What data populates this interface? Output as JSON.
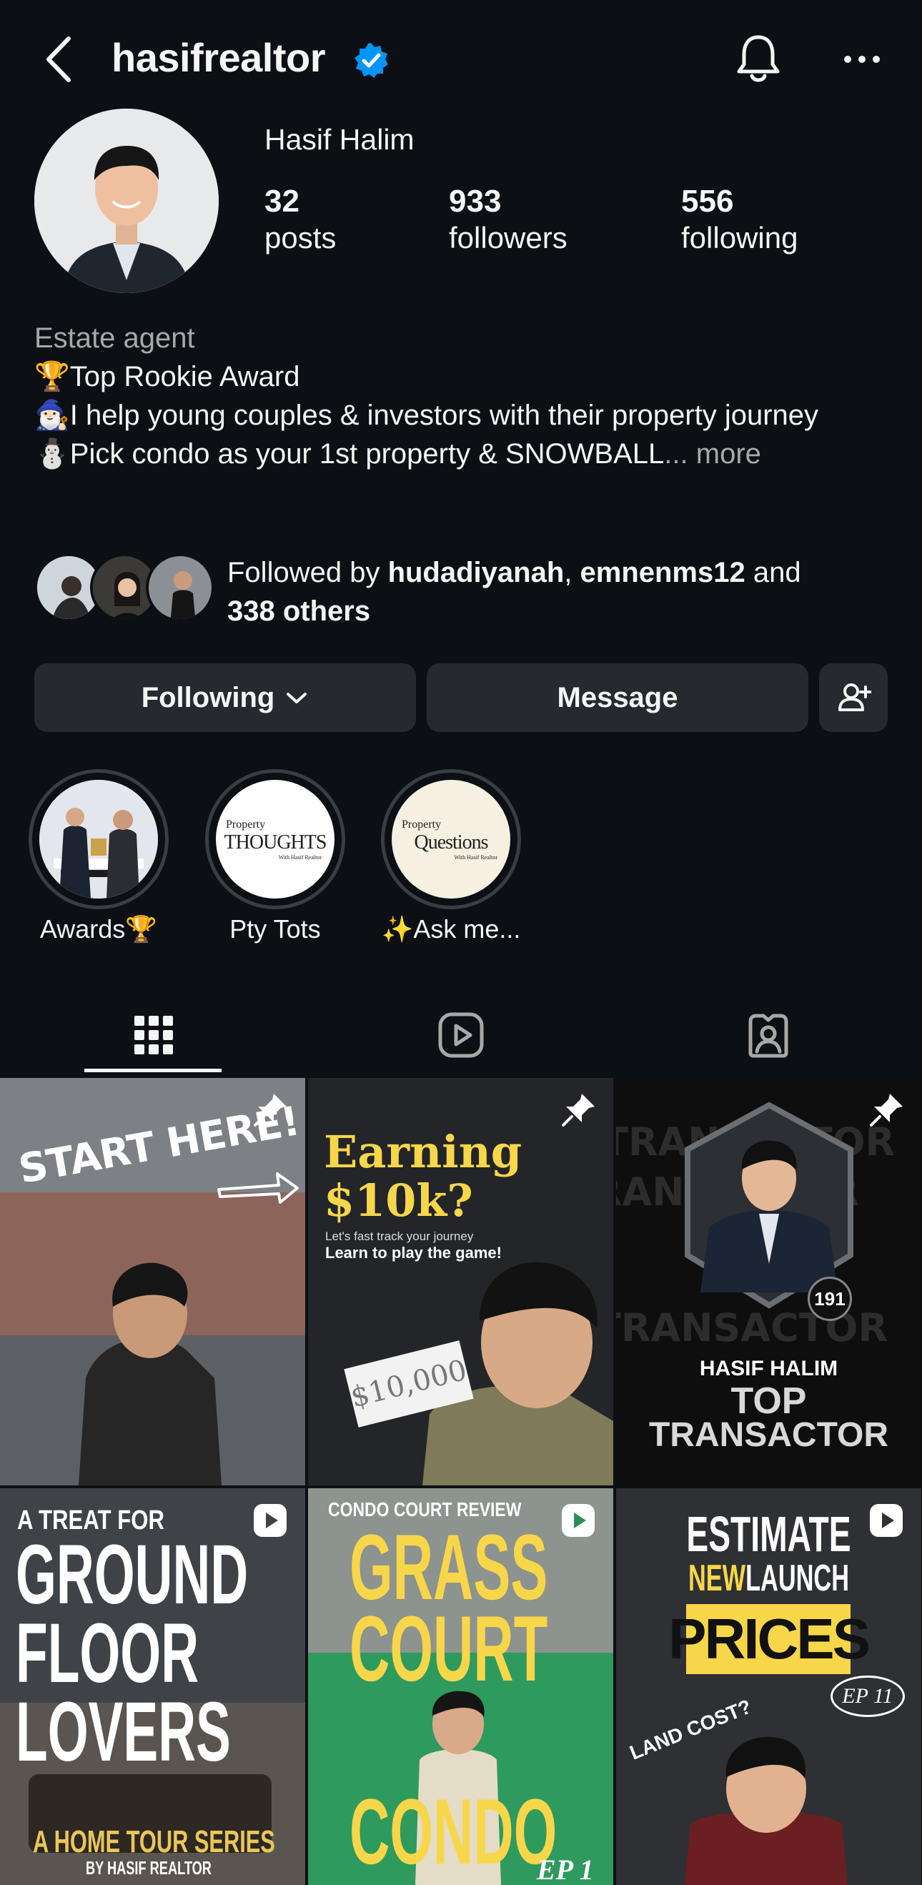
{
  "header": {
    "username": "hasifrealtor",
    "icons": [
      "back-arrow-icon",
      "verified-badge-icon",
      "bell-icon",
      "more-dots-icon"
    ]
  },
  "profile": {
    "display_name": "Hasif Halim",
    "stats": [
      {
        "value": "32",
        "label": "posts"
      },
      {
        "value": "933",
        "label": "followers"
      },
      {
        "value": "556",
        "label": "following"
      }
    ]
  },
  "bio": {
    "category": "Estate agent",
    "lines": [
      "🏆Top Rookie Award",
      "🧙🏻‍♂️I help young couples & investors with their property journey",
      "⛄Pick condo as your 1st property & SNOWBALL"
    ],
    "ellipsis": "...",
    "more": "more"
  },
  "followed_by": {
    "prefix": "Followed by ",
    "user1": "hudadiyanah",
    "sep": ", ",
    "user2": "emnenms12",
    "and": " and",
    "others": "338 others"
  },
  "actions": {
    "following": "Following",
    "message": "Message"
  },
  "highlights": [
    {
      "label": "Awards🏆",
      "cover_line1": "",
      "cover_line2": ""
    },
    {
      "label": "Pty Tots",
      "cover_line1": "Property",
      "cover_line2": "THOUGHTS",
      "cover_sub": "With Hasif Realtor"
    },
    {
      "label": "✨Ask me...",
      "cover_line1": "Property",
      "cover_line2": "Questions",
      "cover_sub": "With Hasif Realtor"
    }
  ],
  "tabs": [
    "grid-icon",
    "reels-icon",
    "tagged-icon"
  ],
  "posts": [
    {
      "title": "START HERE!",
      "badge": "pin"
    },
    {
      "title": "Earning $10k?",
      "sub1": "Let's fast track your journey",
      "sub2": "Learn to play the game!",
      "note": "$10,000",
      "badge": "pin"
    },
    {
      "title": "HASIF HALIM",
      "title2": "TOP",
      "title3": "TRANSACTOR",
      "number": "191",
      "bg_word": "TRANSACTOR",
      "badge": "pin"
    },
    {
      "title": "A TREAT FOR",
      "title2": "GROUND",
      "title3": "FLOOR",
      "title4": "LOVERS",
      "sub1": "A HOME TOUR SERIES",
      "sub2": "BY HASIF REALTOR",
      "badge": "reel"
    },
    {
      "title": "CONDO COURT REVIEW",
      "title2": "GRASS",
      "title3": "COURT",
      "title4": "CONDO",
      "ep": "EP 1",
      "badge": "reel"
    },
    {
      "title": "ESTIMATE",
      "title2": "NEW",
      "title3": "LAUNCH",
      "title4": "PRICES",
      "sub1": "LAND COST?",
      "ep": "EP 11",
      "badge": "reel"
    }
  ],
  "colors": {
    "background": "#0c1014",
    "button": "#262a2f",
    "verified": "#0095f6",
    "secondary_text": "#a8a8a8",
    "post_yellow": "#f7d64a"
  }
}
